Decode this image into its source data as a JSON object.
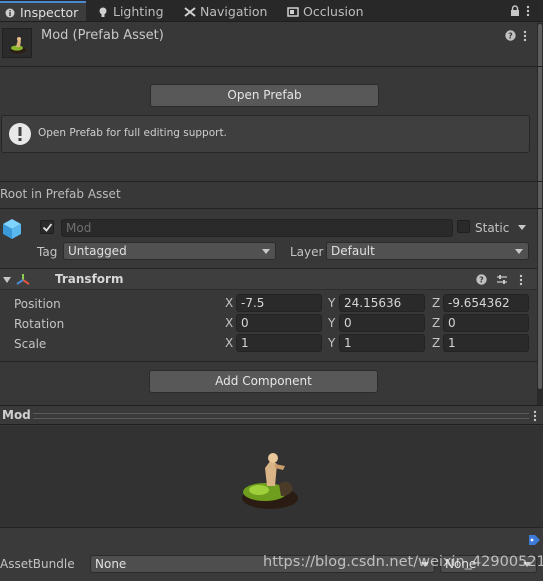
{
  "tabs": [
    {
      "label": "Inspector",
      "icon": "info-icon"
    },
    {
      "label": "Lighting",
      "icon": "bulb-icon"
    },
    {
      "label": "Navigation",
      "icon": "navigation-icon"
    },
    {
      "label": "Occlusion",
      "icon": "occlusion-icon"
    }
  ],
  "header": {
    "title": "Mod (Prefab Asset)"
  },
  "prefab": {
    "open_button": "Open Prefab",
    "info_message": "Open Prefab for full editing support."
  },
  "root_label": "Root in Prefab Asset",
  "object": {
    "name_placeholder": "Mod",
    "static_label": "Static",
    "tag_label": "Tag",
    "tag_value": "Untagged",
    "layer_label": "Layer",
    "layer_value": "Default"
  },
  "transform": {
    "title": "Transform",
    "rows": [
      {
        "label": "Position",
        "x": "-7.5",
        "y": "24.15636",
        "z": "-9.654362"
      },
      {
        "label": "Rotation",
        "x": "0",
        "y": "0",
        "z": "0"
      },
      {
        "label": "Scale",
        "x": "1",
        "y": "1",
        "z": "1"
      }
    ],
    "axis_x": "X",
    "axis_y": "Y",
    "axis_z": "Z"
  },
  "add_component": "Add Component",
  "preview": {
    "title": "Mod"
  },
  "assetbundle": {
    "label": "AssetBundle",
    "value": "None",
    "variant_value": "None"
  },
  "watermark": "https://blog.csdn.net/weixin_42900521",
  "colors": {
    "accent": "#4a8ad0",
    "background": "#383838",
    "field": "#2a2a2a"
  }
}
